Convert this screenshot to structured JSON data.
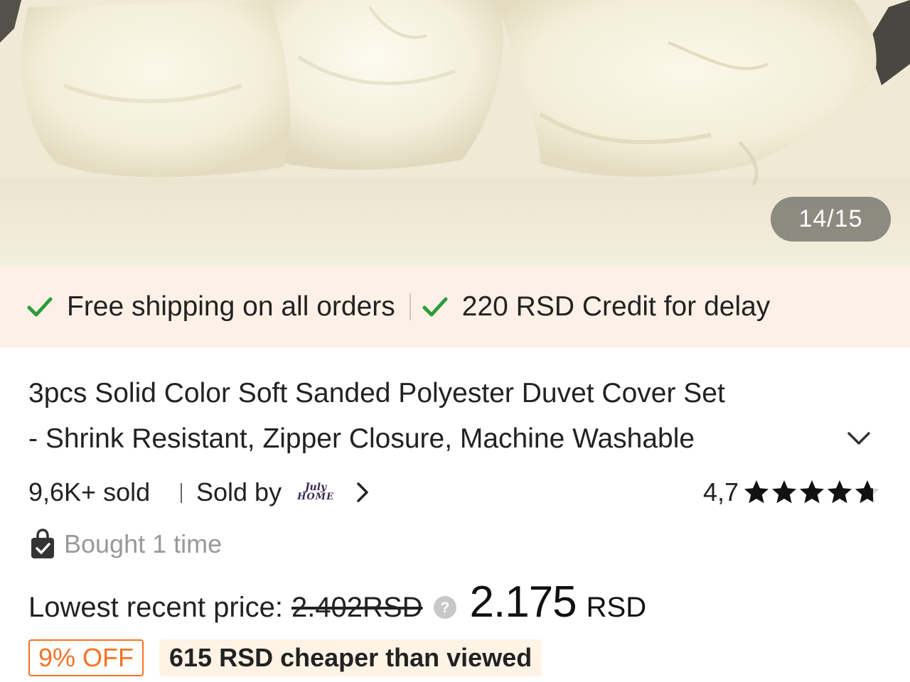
{
  "gallery": {
    "counter": "14/15",
    "image_alt": "cream duvet cover set"
  },
  "shipping": {
    "free_shipping": "Free shipping on all orders",
    "delay_credit": "220 RSD Credit for delay",
    "check_color": "#2a9d3a",
    "banner_color": "#fdf1e7"
  },
  "product": {
    "title_line1": "3pcs Solid Color Soft Sanded Polyester Duvet Cover Set",
    "title_line2": "- Shrink Resistant, Zipper Closure, Machine Washable",
    "sold": "9,6K+ sold",
    "sold_by_label": "Sold by",
    "seller_logo_line1": "July",
    "seller_logo_line2": "HOME",
    "rating": "4,7",
    "rating_stars_value": 4.7,
    "bought": "Bought 1 time"
  },
  "price": {
    "label": "Lowest recent price:",
    "old_price": "2.402RSD",
    "new_price": "2.175",
    "currency": "RSD"
  },
  "discount": {
    "off_badge": "9% OFF",
    "cheaper_text": "615 RSD cheaper than viewed",
    "accent_color": "#f57224"
  }
}
